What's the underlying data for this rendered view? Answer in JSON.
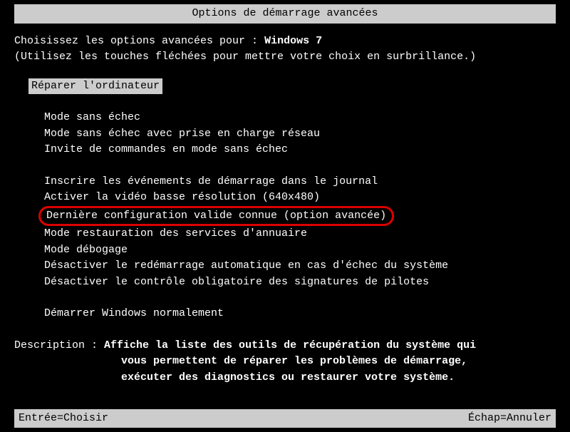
{
  "title": "Options de démarrage avancées",
  "prompt": {
    "prefix": "Choisissez les options avancées pour : ",
    "os": "Windows 7"
  },
  "instructions": "(Utilisez les touches fléchées pour mettre votre choix en surbrillance.)",
  "selected_option": "Réparer l'ordinateur",
  "group1": [
    "Mode sans échec",
    "Mode sans échec avec prise en charge réseau",
    "Invite de commandes en mode sans échec"
  ],
  "group2": {
    "items_before": [
      "Inscrire les événements de démarrage dans le journal",
      "Activer la vidéo basse résolution (640x480)"
    ],
    "circled": "Dernière configuration valide connue (option avancée)",
    "items_after": [
      "Mode restauration des services d'annuaire",
      "Mode débogage",
      "Désactiver le redémarrage automatique en cas d'échec du système",
      "Désactiver le contrôle obligatoire des signatures de pilotes"
    ]
  },
  "group3": [
    "Démarrer Windows normalement"
  ],
  "description": {
    "label": "Description : ",
    "line1": "Affiche la liste des outils de récupération du système qui",
    "line2": "vous permettent de réparer les problèmes de démarrage,",
    "line3": "exécuter des diagnostics ou restaurer votre système."
  },
  "footer": {
    "left": "Entrée=Choisir",
    "right": "Échap=Annuler"
  }
}
